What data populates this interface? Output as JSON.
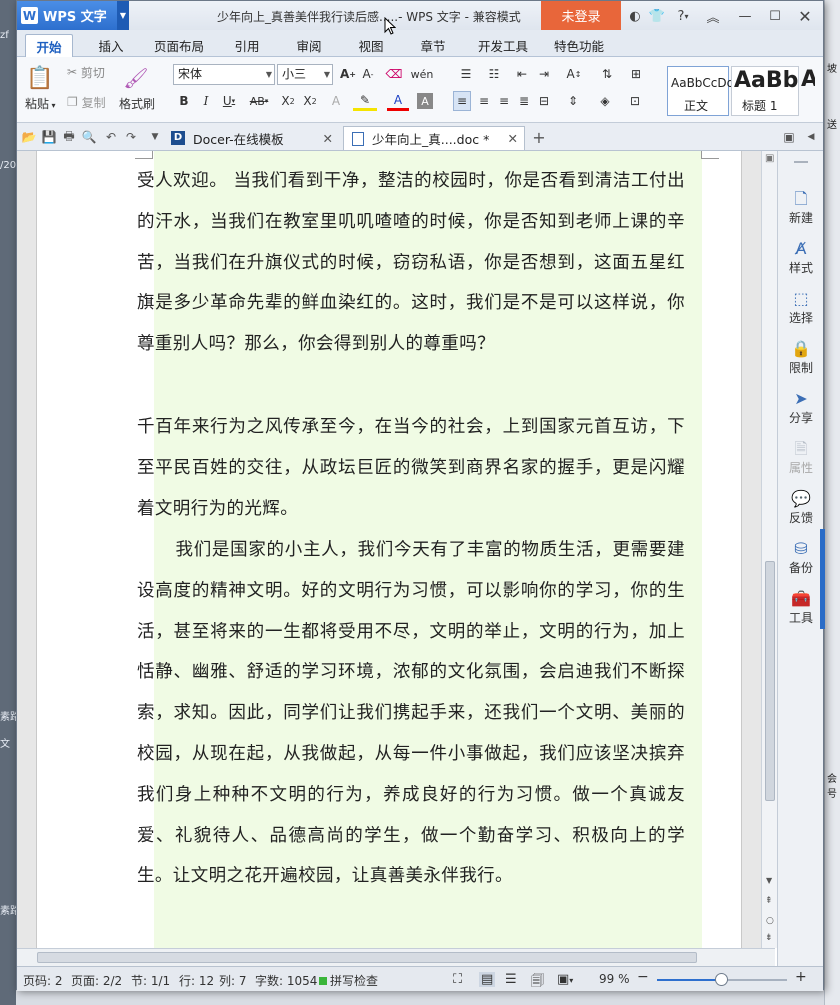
{
  "window": {
    "app_name": "WPS 文字",
    "logo_letter": "W",
    "title": "少年向上_真善美伴我行读后感.....- WPS 文字 - 兼容模式",
    "login_label": "未登录",
    "help_label": "?"
  },
  "menu": {
    "tabs": [
      "开始",
      "插入",
      "页面布局",
      "引用",
      "审阅",
      "视图",
      "章节",
      "开发工具",
      "特色功能"
    ],
    "active": "开始"
  },
  "ribbon": {
    "paste": "粘贴",
    "cut": "剪切",
    "copy": "复制",
    "format_painter": "格式刷",
    "font_name": "宋体",
    "font_size": "小三",
    "styles": [
      {
        "preview": "AaBbCcDd",
        "name": "正文"
      },
      {
        "preview": "AaBb",
        "name": "标题 1"
      },
      {
        "preview": "A",
        "name": ""
      }
    ]
  },
  "doc_tabs": [
    {
      "label": "Docer-在线模板",
      "active": false
    },
    {
      "label": "少年向上_真....doc *",
      "active": true
    }
  ],
  "document": {
    "paragraphs": [
      "受人欢迎。 当我们看到干净，整洁的校园时，你是否看到清洁工付出的汗水，当我们在教室里叽叽喳喳的时候，你是否知到老师上课的辛苦，当我们在升旗仪式的时候，窃窃私语，你是否想到，这面五星红旗是多少革命先辈的鲜血染红的。这时，我们是不是可以这样说，你尊重别人吗？那么，你会得到别人的尊重吗？",
      "千百年来行为之风传承至今，在当今的社会，上到国家元首互访，下至平民百姓的交往，从政坛巨匠的微笑到商界名家的握手，更是闪耀着文明行为的光辉。",
      "我们是国家的小主人，我们今天有了丰富的物质生活，更需要建设高度的精神文明。好的文明行为习惯，可以影响你的学习，你的生活，甚至将来的一生都将受用不尽，文明的举止，文明的行为，加上恬静、幽雅、舒适的学习环境，浓郁的文化氛围，会启迪我们不断探索，求知。因此，同学们让我们携起手来，还我们一个文明、美丽的校园，从现在起，从我做起，从每一件小事做起，我们应该坚决摈弃我们身上种种不文明的行为，养成良好的行为习惯。做一个真诚友爱、礼貌待人、品德高尚的学生，做一个勤奋学习、积极向上的学生。让文明之花开遍校园，让真善美永伴我行。"
    ]
  },
  "side_panel": [
    {
      "label": "新建",
      "icon": "new-doc-icon",
      "enabled": true
    },
    {
      "label": "样式",
      "icon": "style-icon",
      "enabled": true
    },
    {
      "label": "选择",
      "icon": "select-icon",
      "enabled": true
    },
    {
      "label": "限制",
      "icon": "restrict-icon",
      "enabled": true
    },
    {
      "label": "分享",
      "icon": "share-icon",
      "enabled": true
    },
    {
      "label": "属性",
      "icon": "properties-icon",
      "enabled": false
    },
    {
      "label": "反馈",
      "icon": "feedback-icon",
      "enabled": true
    },
    {
      "label": "备份",
      "icon": "backup-icon",
      "enabled": true
    },
    {
      "label": "工具",
      "icon": "tools-icon",
      "enabled": true
    }
  ],
  "status": {
    "page_num": "页码: 2",
    "pages": "页面: 2/2",
    "section": "节: 1/1",
    "row": "行: 12",
    "col": "列: 7",
    "word_count": "字数: 1054",
    "spell_check": "拼写检查",
    "zoom": "99 %",
    "zoom_level": 0.5
  },
  "background_bits": [
    "zf",
    "/20",
    "素路",
    "文",
    "素路",
    "坡",
    "送",
    "会号"
  ],
  "colors": {
    "accent": "#2d6fce",
    "login": "#e8663a",
    "text_highlight": "#f0fbe4"
  }
}
